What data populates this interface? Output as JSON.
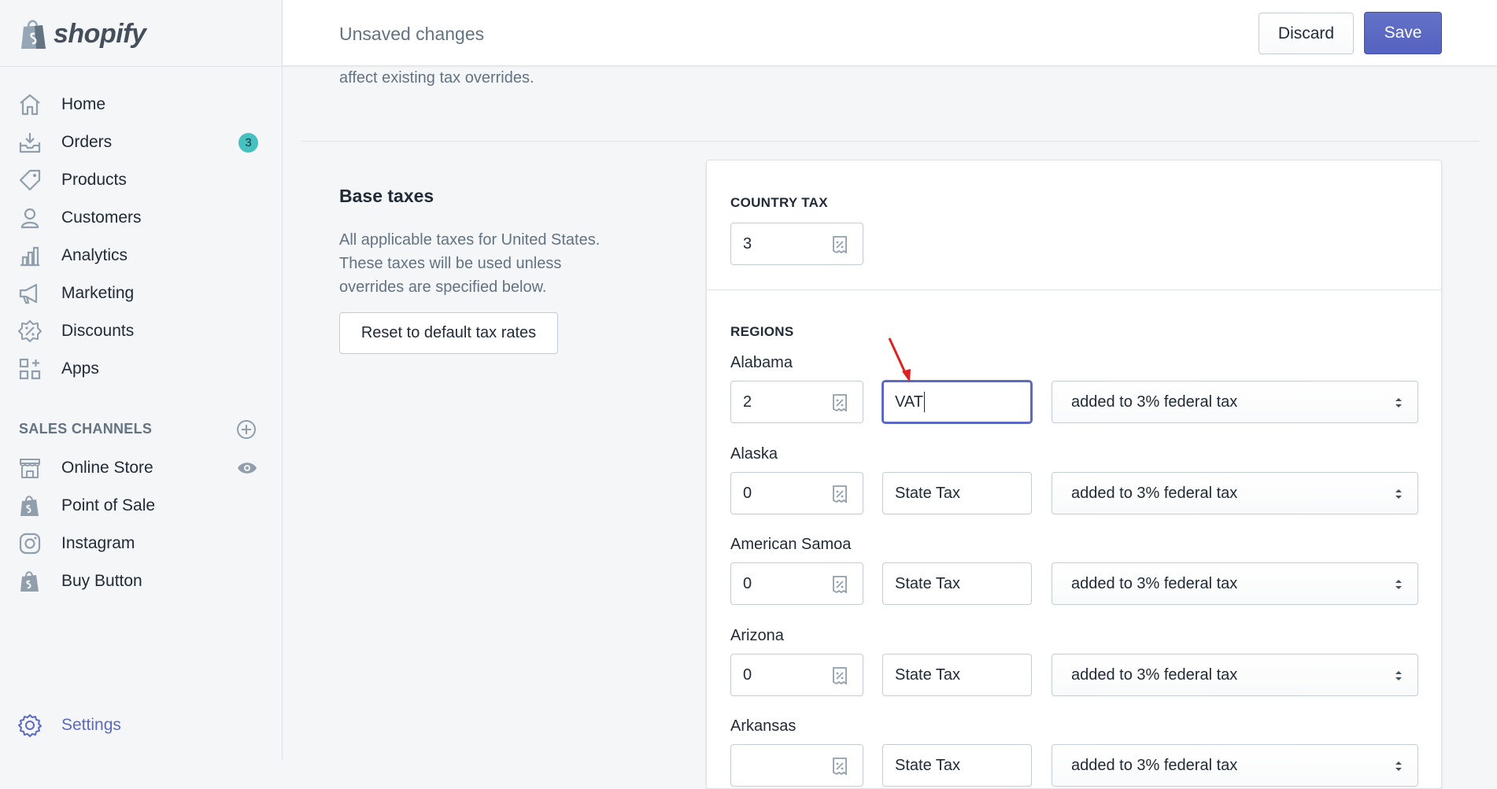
{
  "brand": {
    "name": "shopify"
  },
  "nav": {
    "items": [
      {
        "label": "Home"
      },
      {
        "label": "Orders",
        "badge": "3"
      },
      {
        "label": "Products"
      },
      {
        "label": "Customers"
      },
      {
        "label": "Analytics"
      },
      {
        "label": "Marketing"
      },
      {
        "label": "Discounts"
      },
      {
        "label": "Apps"
      }
    ],
    "sales_channels_heading": "SALES CHANNELS",
    "channels": [
      {
        "label": "Online Store"
      },
      {
        "label": "Point of Sale"
      },
      {
        "label": "Instagram"
      },
      {
        "label": "Buy Button"
      }
    ],
    "settings_label": "Settings"
  },
  "topbar": {
    "title": "Unsaved changes",
    "discard_label": "Discard",
    "save_label": "Save"
  },
  "main": {
    "prev_text": "affect existing tax overrides.",
    "section_title": "Base taxes",
    "section_desc": "All applicable taxes for United States. These taxes will be used unless overrides are specified below.",
    "reset_label": "Reset to default tax rates"
  },
  "card": {
    "country_heading": "COUNTRY TAX",
    "country_rate": "3",
    "regions_heading": "REGIONS",
    "regions": [
      {
        "name": "Alabama",
        "rate": "2",
        "tax_name": "VAT",
        "mode": "added to 3% federal tax"
      },
      {
        "name": "Alaska",
        "rate": "0",
        "tax_name": "State Tax",
        "mode": "added to 3% federal tax"
      },
      {
        "name": "American Samoa",
        "rate": "0",
        "tax_name": "State Tax",
        "mode": "added to 3% federal tax"
      },
      {
        "name": "Arizona",
        "rate": "0",
        "tax_name": "State Tax",
        "mode": "added to 3% federal tax"
      },
      {
        "name": "Arkansas",
        "rate": "",
        "tax_name": "State Tax",
        "mode": "added to 3% federal tax"
      }
    ]
  },
  "colors": {
    "accent": "#5c6ac4",
    "badge": "#47c1bf",
    "annotation_arrow": "#e02020"
  }
}
